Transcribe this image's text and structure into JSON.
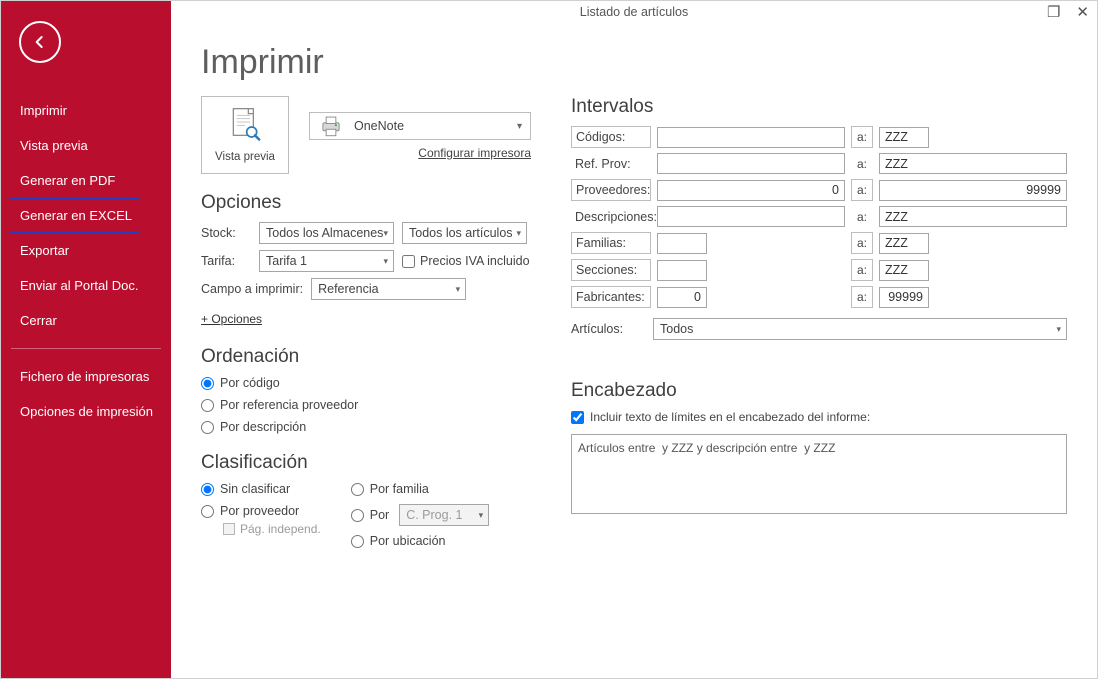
{
  "window_title": "Listado de artículos",
  "page_title": "Imprimir",
  "sidebar": {
    "items": [
      "Imprimir",
      "Vista previa",
      "Generar en PDF",
      "Generar en EXCEL",
      "Exportar",
      "Enviar al Portal Doc.",
      "Cerrar"
    ],
    "items2": [
      "Fichero de impresoras",
      "Opciones de impresión"
    ]
  },
  "preview_button": "Vista previa",
  "printer": {
    "name": "OneNote",
    "configure_link": "Configurar impresora"
  },
  "sections": {
    "options_title": "Opciones",
    "ordering_title": "Ordenación",
    "classification_title": "Clasificación",
    "intervals_title": "Intervalos",
    "header_title": "Encabezado"
  },
  "options": {
    "stock_label": "Stock:",
    "stock_value": "Todos los Almacenes",
    "articles_value": "Todos los artículos",
    "tariff_label": "Tarifa:",
    "tariff_value": "Tarifa 1",
    "vat_label": "Precios IVA incluido",
    "print_field_label": "Campo a imprimir:",
    "print_field_value": "Referencia",
    "more_link": "+ Opciones"
  },
  "ordering": [
    "Por código",
    "Por referencia proveedor",
    "Por descripción"
  ],
  "classification": {
    "col1": [
      "Sin clasificar",
      "Por proveedor"
    ],
    "col2": [
      "Por familia",
      "Por",
      "Por ubicación"
    ],
    "cprog_value": "C. Prog. 1",
    "indep_label": "Pág. independ."
  },
  "intervals": {
    "rows": [
      {
        "label": "Códigos:",
        "boxed": true,
        "from": "",
        "to": "ZZZ",
        "right": false,
        "short_to": true
      },
      {
        "label": "Ref. Prov:",
        "boxed": false,
        "from": "",
        "to": "ZZZ",
        "right": false
      },
      {
        "label": "Proveedores:",
        "boxed": true,
        "from": "0",
        "to": "99999",
        "right": true
      },
      {
        "label": "Descripciones:",
        "boxed": false,
        "from": "",
        "to": "ZZZ",
        "right": false
      },
      {
        "label": "Familias:",
        "boxed": true,
        "from": "",
        "to": "ZZZ",
        "right": false,
        "short": true
      },
      {
        "label": "Secciones:",
        "boxed": true,
        "from": "",
        "to": "ZZZ",
        "right": false,
        "short": true
      },
      {
        "label": "Fabricantes:",
        "boxed": true,
        "from": "0",
        "to": "99999",
        "right": true,
        "short": true
      }
    ],
    "a_label": "a:",
    "articulos_label": "Artículos:",
    "articulos_value": "Todos"
  },
  "encabezado": {
    "checkbox_label": "Incluir texto de límites en el encabezado del informe:",
    "text": "Artículos entre  y ZZZ y descripción entre  y ZZZ"
  }
}
